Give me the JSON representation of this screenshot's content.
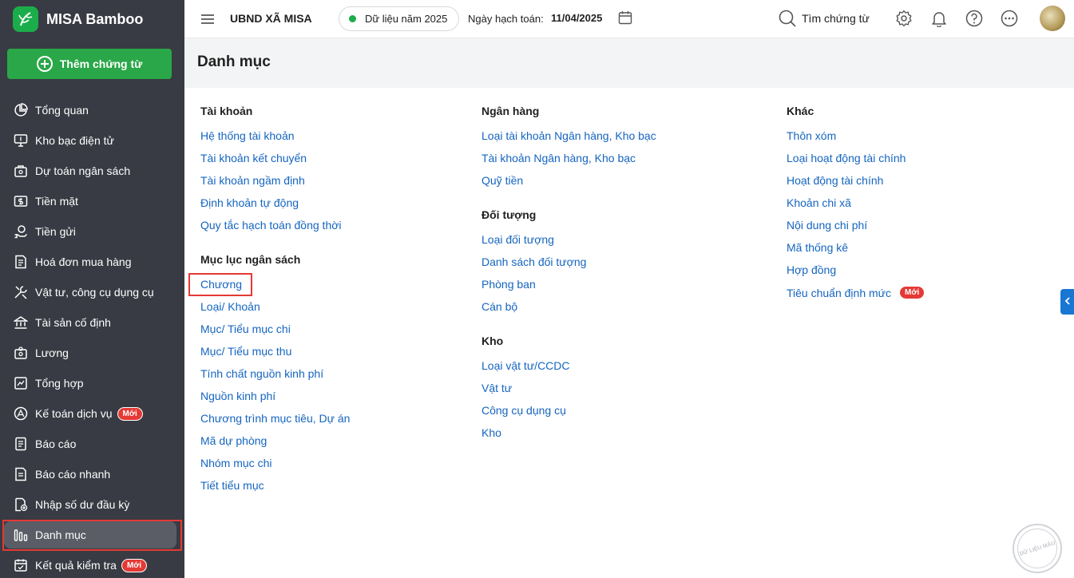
{
  "brand": {
    "name": "MISA Bamboo"
  },
  "sidebar": {
    "add_button": "Thêm chứng từ",
    "new_badge": "Mới",
    "items": [
      {
        "label": "Tổng quan",
        "icon": "pie-chart-icon"
      },
      {
        "label": "Kho bạc điện tử",
        "icon": "monitor-icon"
      },
      {
        "label": "Dự toán ngân sách",
        "icon": "budget-icon"
      },
      {
        "label": "Tiền mặt",
        "icon": "cash-icon"
      },
      {
        "label": "Tiền gửi",
        "icon": "deposit-icon"
      },
      {
        "label": "Hoá đơn mua hàng",
        "icon": "invoice-icon"
      },
      {
        "label": "Vật tư, công cụ dụng cụ",
        "icon": "tools-icon"
      },
      {
        "label": "Tài sản cố định",
        "icon": "bank-icon"
      },
      {
        "label": "Lương",
        "icon": "salary-icon"
      },
      {
        "label": "Tổng hợp",
        "icon": "summary-icon"
      },
      {
        "label": "Kế toán dịch vụ",
        "icon": "service-icon"
      },
      {
        "label": "Báo cáo",
        "icon": "report-icon"
      },
      {
        "label": "Báo cáo nhanh",
        "icon": "quick-report-icon"
      },
      {
        "label": "Nhập số dư đầu kỳ",
        "icon": "opening-balance-icon"
      },
      {
        "label": "Danh mục",
        "icon": "catalog-icon"
      },
      {
        "label": "Kết quả kiểm tra",
        "icon": "check-result-icon"
      }
    ]
  },
  "topbar": {
    "org_name": "UBND XÃ MISA",
    "year_label": "Dữ liệu năm 2025",
    "posting_date_label": "Ngày hạch toán:",
    "posting_date_value": "11/04/2025",
    "search_label": "Tìm chứng từ"
  },
  "page": {
    "title": "Danh mục"
  },
  "catalog": {
    "col1": [
      {
        "title": "Tài khoản",
        "links": [
          "Hệ thống tài khoản",
          "Tài khoản kết chuyển",
          "Tài khoản ngầm định",
          "Định khoản tự động",
          "Quy tắc hạch toán đồng thời"
        ]
      },
      {
        "title": "Mục lục ngân sách",
        "links": [
          "Chương",
          "Loại/ Khoản",
          "Mục/ Tiểu mục chi",
          "Mục/ Tiểu mục thu",
          "Tính chất nguồn kinh phí",
          "Nguồn kinh phí",
          "Chương trình mục tiêu, Dự án",
          "Mã dự phòng",
          "Nhóm mục chi",
          "Tiết tiểu mục"
        ]
      }
    ],
    "col2": [
      {
        "title": "Ngân hàng",
        "links": [
          "Loại tài khoản Ngân hàng, Kho bạc",
          "Tài khoản Ngân hàng, Kho bạc",
          "Quỹ tiền"
        ]
      },
      {
        "title": "Đối tượng",
        "links": [
          "Loại đối tượng",
          "Danh sách đối tượng",
          "Phòng ban",
          "Cán bộ"
        ]
      },
      {
        "title": "Kho",
        "links": [
          "Loại vật tư/CCDC",
          "Vật tư",
          "Công cụ dụng cụ",
          "Kho"
        ]
      }
    ],
    "col3": [
      {
        "title": "Khác",
        "links": [
          "Thôn xóm",
          "Loại hoạt động tài chính",
          "Hoạt động tài chính",
          "Khoản chi xã",
          "Nội dung chi phí",
          "Mã thống kê",
          "Hợp đồng",
          "Tiêu chuẩn định mức"
        ]
      }
    ]
  },
  "watermark": "DỮ LIỆU MẪU",
  "colors": {
    "sidebar_bg": "#383b43",
    "accent_green": "#2aa748",
    "link_blue": "#1565c0",
    "badge_red": "#e53935"
  }
}
